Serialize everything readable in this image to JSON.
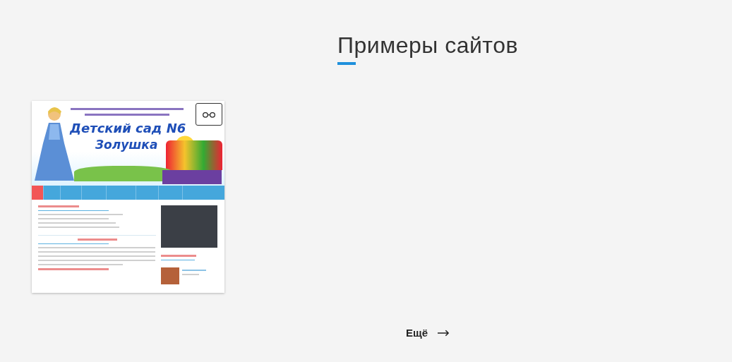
{
  "section": {
    "title": "Примеры сайтов"
  },
  "thumbnail": {
    "banner": {
      "title": "Детский сад N6",
      "name": "Золушка"
    }
  },
  "more": {
    "label": "Ещё"
  }
}
